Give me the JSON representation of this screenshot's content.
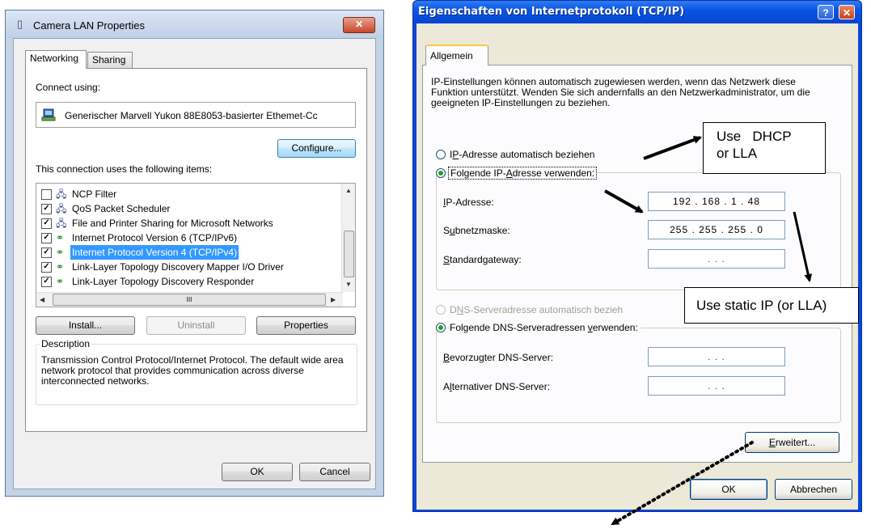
{
  "left_dialog": {
    "title": "Camera LAN Properties",
    "close_label": "✕",
    "tabs": [
      {
        "label": "Networking"
      },
      {
        "label": "Sharing"
      }
    ],
    "connect_using_label": "Connect using:",
    "adapter_name": "Generischer Marvell Yukon 88E8053-basierter Ethemet-Cc",
    "configure_label": "Configure...",
    "items_label": "This connection uses the following items:",
    "items": [
      {
        "label": "NCP Filter",
        "checked": false
      },
      {
        "label": "QoS Packet Scheduler",
        "checked": true
      },
      {
        "label": "File and Printer Sharing for Microsoft Networks",
        "checked": true
      },
      {
        "label": "Internet Protocol Version 6 (TCP/IPv6)",
        "checked": true
      },
      {
        "label": "Internet Protocol Version 4 (TCP/IPv4)",
        "checked": true,
        "selected": true
      },
      {
        "label": "Link-Layer Topology Discovery Mapper I/O Driver",
        "checked": true
      },
      {
        "label": "Link-Layer Topology Discovery Responder",
        "checked": true
      }
    ],
    "hscroll_thumb": "III",
    "install_label": "Install...",
    "uninstall_label": "Uninstall",
    "properties_label": "Properties",
    "description_legend": "Description",
    "description_text": "Transmission Control Protocol/Internet Protocol. The default wide area network protocol that provides communication across diverse interconnected networks.",
    "ok_label": "OK",
    "cancel_label": "Cancel"
  },
  "right_dialog": {
    "title": "Eigenschaften von Internetprotokoll (TCP/IP)",
    "help_label": "?",
    "close_label": "✕",
    "tab_label": "Allgemein",
    "intro": "IP-Einstellungen können automatisch zugewiesen werden, wenn das Netzwerk diese Funktion unterstützt. Wenden Sie sich andernfalls an den Netzwerkadministrator, um die geeigneten IP-Einstellungen zu beziehen.",
    "radio_auto_ip": {
      "pre": "I",
      "u": "P",
      "post": "-Adresse automatisch beziehen"
    },
    "radio_static_ip": {
      "pre": "Folgende IP-",
      "u": "A",
      "post": "dresse verwenden:"
    },
    "ip_label": {
      "u": "I",
      "post": "P-Adresse:"
    },
    "ip_value": "192 . 168 .  1  .  48",
    "subnet_label": {
      "pre": "S",
      "u": "u",
      "post": "bnetzmaske:"
    },
    "subnet_value": "255 . 255 . 255 .  0",
    "gateway_label": {
      "u": "S",
      "post": "tandardgateway:"
    },
    "empty_ip": ".       .       .",
    "radio_auto_dns": {
      "pre": "D",
      "u": "N",
      "post": "S-Serveradresse automatisch bezieh"
    },
    "radio_static_dns": {
      "pre": "Folgende DNS-Serveradressen ",
      "u": "v",
      "post": "erwenden:"
    },
    "preferred_dns_label": {
      "u": "B",
      "post": "evorzugter DNS-Server:"
    },
    "alternate_dns_label": {
      "pre": "A",
      "u": "l",
      "post": "ternativer DNS-Server:"
    },
    "advanced_label": {
      "u": "E",
      "post": "rweitert..."
    },
    "ok_label": "OK",
    "cancel_label": "Abbrechen"
  },
  "annotations": {
    "dhcp": "Use   DHCP\nor LLA",
    "static": "Use static IP (or LLA)"
  },
  "colors": {
    "vista_frame": "#c4d3e6",
    "xp_blue": "#0a46d8",
    "xp_face": "#ece9d8",
    "selection": "#3399ff",
    "radio_dot": "#21a121"
  }
}
